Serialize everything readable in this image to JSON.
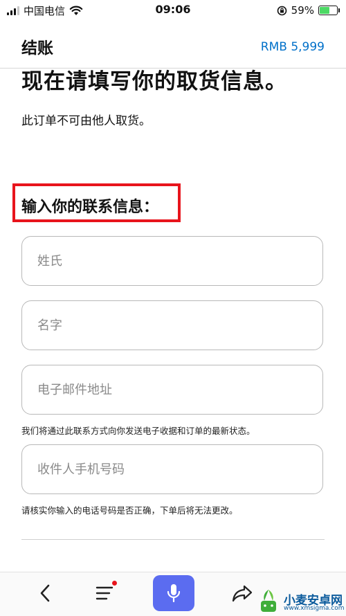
{
  "status_bar": {
    "carrier": "中国电信",
    "time": "09:06",
    "battery_percent": "59%"
  },
  "header": {
    "title": "结账",
    "price": "RMB 5,999"
  },
  "page": {
    "title": "现在请填写你的取货信息。",
    "subtitle": "此订单不可由他人取货。"
  },
  "contact_section": {
    "heading": "输入你的联系信息：",
    "fields": {
      "last_name": {
        "placeholder": "姓氏",
        "value": ""
      },
      "first_name": {
        "placeholder": "名字",
        "value": ""
      },
      "email": {
        "placeholder": "电子邮件地址",
        "value": ""
      },
      "phone": {
        "placeholder": "收件人手机号码",
        "value": ""
      }
    },
    "email_helper": "我们将通过此联系方式向你发送电子收据和订单的最新状态。",
    "phone_helper": "请核实你输入的电话号码是否正确，下单后将无法更改。"
  },
  "watermark": {
    "text": "小麦安卓网",
    "url": "www.xmsigma.com"
  },
  "colors": {
    "accent_link": "#0070c9",
    "highlight_box": "#e8141c",
    "mic_button": "#5b6cf0",
    "battery_fill": "#4cd964"
  },
  "icons": {
    "signal": "signal-bars-icon",
    "wifi": "wifi-icon",
    "orientation_lock": "orientation-lock-icon",
    "battery": "battery-charging-icon",
    "back": "chevron-left-icon",
    "menu": "hamburger-menu-icon",
    "mic": "microphone-icon",
    "share": "share-arrow-icon"
  }
}
